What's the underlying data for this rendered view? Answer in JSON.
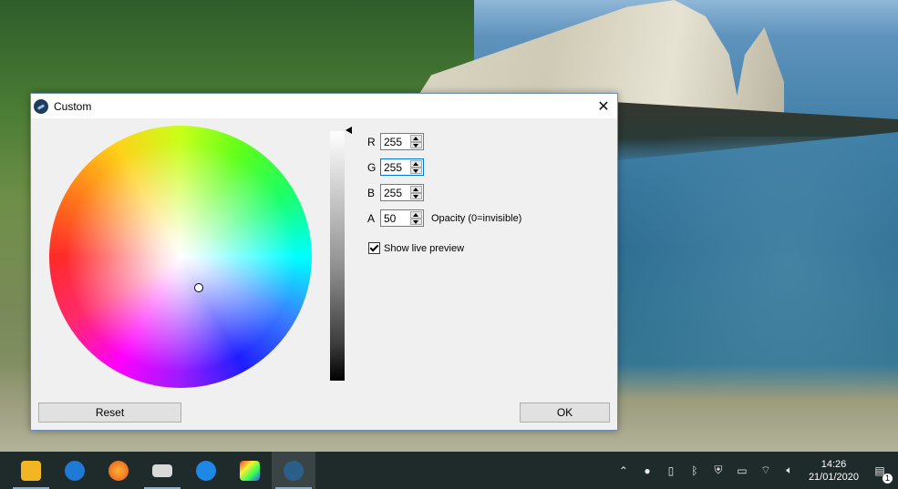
{
  "dialog": {
    "title": "Custom",
    "close_glyph": "✕",
    "fields": [
      {
        "label": "R",
        "value": "255"
      },
      {
        "label": "G",
        "value": "255"
      },
      {
        "label": "B",
        "value": "255"
      },
      {
        "label": "A",
        "value": "50"
      }
    ],
    "opacity_note": "Opacity (0=invisible)",
    "live_preview_label": "Show live preview",
    "live_preview_checked": true,
    "reset_label": "Reset",
    "ok_label": "OK"
  },
  "taskbar": {
    "apps": [
      {
        "name": "file-explorer-icon",
        "color": "#f3b623"
      },
      {
        "name": "edge-icon",
        "color": "#1f7ad6"
      },
      {
        "name": "firefox-icon",
        "color": "#e8561f"
      },
      {
        "name": "app-window-icon",
        "color": "#d9d9d9"
      },
      {
        "name": "s-app-icon",
        "color": "#1e88e5"
      },
      {
        "name": "color-app-icon",
        "color": "#44bb44"
      },
      {
        "name": "color-picker-app-icon",
        "color": "#2b5f8a"
      }
    ],
    "time": "14:26",
    "date": "21/01/2020",
    "notification_count": "1"
  }
}
